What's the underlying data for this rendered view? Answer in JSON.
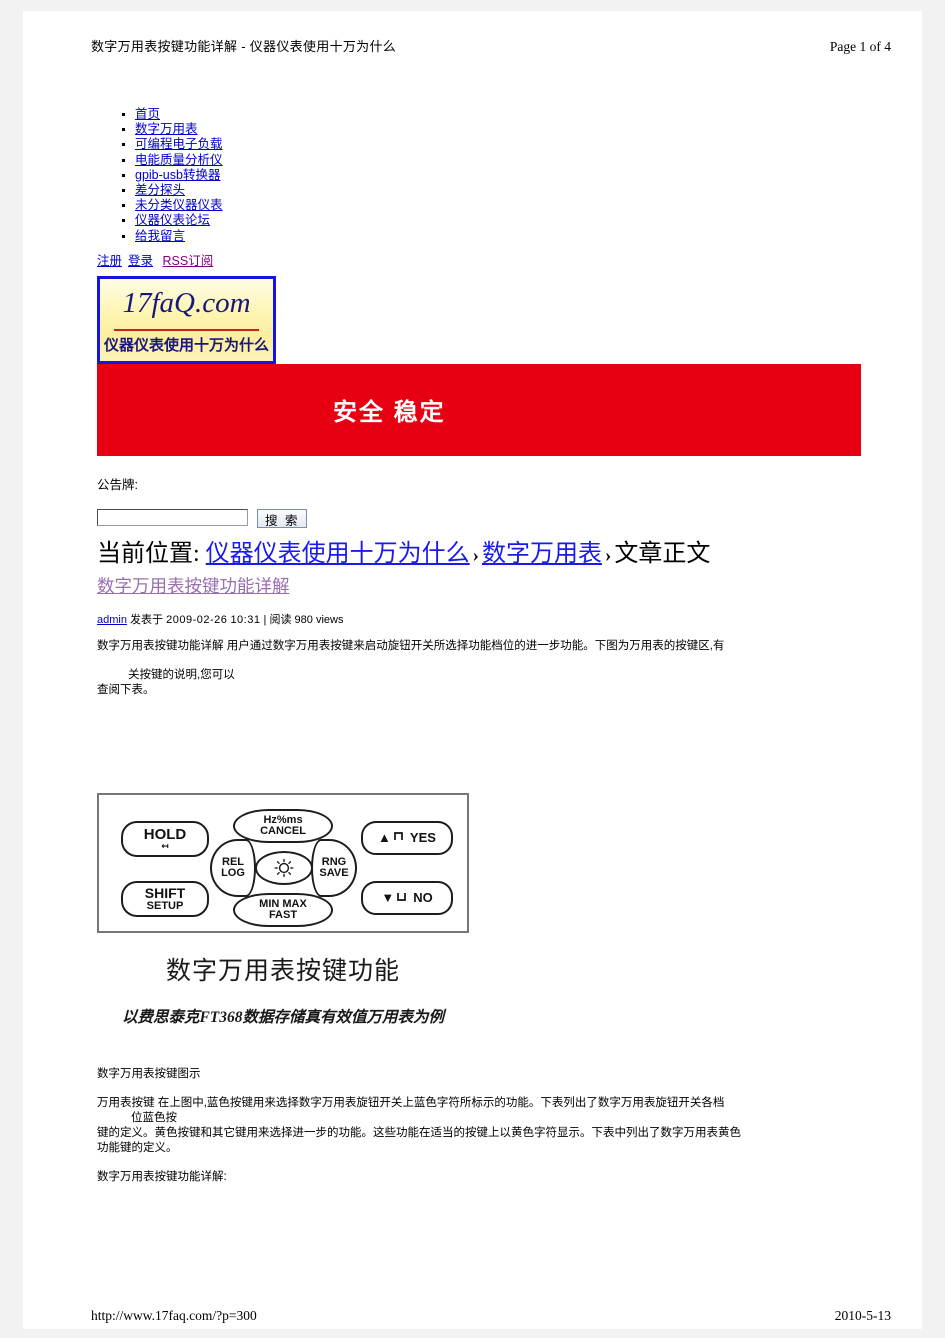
{
  "print_header": {
    "title": "数字万用表按键功能详解 - 仪器仪表使用十万为什么",
    "page_label": "Page 1 of 4"
  },
  "nav": {
    "items": [
      {
        "label": "首页"
      },
      {
        "label": "数字万用表"
      },
      {
        "label": "可编程电子负载"
      },
      {
        "label": "电能质量分析仪"
      },
      {
        "label": "gpib-usb转换器"
      },
      {
        "label": "差分探头"
      },
      {
        "label": "未分类仪器仪表"
      },
      {
        "label": "仪器仪表论坛"
      },
      {
        "label": "给我留言"
      }
    ]
  },
  "account_links": {
    "register": "注册",
    "login": "登录",
    "rss": "RSS订阅"
  },
  "logo": {
    "brand": "17faQ.com",
    "tagline": "仪器仪表使用十万为什么",
    "border_color": "#1515e0",
    "text_color": "#17177c",
    "rule_color": "#cf2020"
  },
  "banner": {
    "text": "安全    稳定",
    "background": "#e60012",
    "text_color": "#ffffff"
  },
  "notice": {
    "label": "公告牌:"
  },
  "search": {
    "value": "",
    "placeholder": "",
    "button_label": "搜 索"
  },
  "breadcrumb": {
    "prefix": "当前位置:",
    "crumb1": "仪器仪表使用十万为什么",
    "sep1": "›",
    "crumb2": "数字万用表",
    "sep2": "›",
    "current": "文章正文"
  },
  "article": {
    "title": "数字万用表按键功能详解",
    "author": "admin",
    "posted_label": "发表于",
    "date": "2009-02-26",
    "time": "10:31",
    "divider": "|",
    "views_label": "阅读",
    "views_count": "980",
    "views_unit": "views",
    "para1_line1": "数字万用表按键功能详解  用户通过数字万用表按键来启动旋钮开关所选择功能档位的进一步功能。下图为万用表的按键区,有",
    "para1_line2": "关按键的说明,您可以",
    "para1_line3": "查阅下表。",
    "para2": "数字万用表按键图示",
    "para3_line1": "万用表按键 在上图中,蓝色按键用来选择数字万用表旋钮开关上蓝色字符所标示的功能。下表列出了数字万用表旋钮开关各档",
    "para3_line2": "位蓝色按",
    "para3_line3": "键的定义。黄色按键和其它键用来选择进一步的功能。这些功能在适当的按键上以黄色字符显示。下表中列出了数字万用表黄色",
    "para3_line4": "功能键的定义。",
    "para4": "数字万用表按键功能详解:"
  },
  "figure": {
    "keys": {
      "hold": "HOLD",
      "shift_main": "SHIFT",
      "shift_sub": "SETUP",
      "top_main": "Hz%ms",
      "top_sub": "CANCEL",
      "left_main": "REL",
      "left_sub": "LOG",
      "right_main": "RNG",
      "right_sub": "SAVE",
      "bottom_main": "MIN MAX",
      "bottom_sub": "FAST",
      "yes": "YES",
      "no": "NO",
      "up_arrow": "▲",
      "down_arrow": "▼"
    },
    "caption_main": "数字万用表按键功能",
    "caption_sub": "以费思泰克FT368数据存储真有效值万用表为例"
  },
  "print_footer": {
    "url": "http://www.17faq.com/?p=300",
    "date": "2010-5-13"
  }
}
